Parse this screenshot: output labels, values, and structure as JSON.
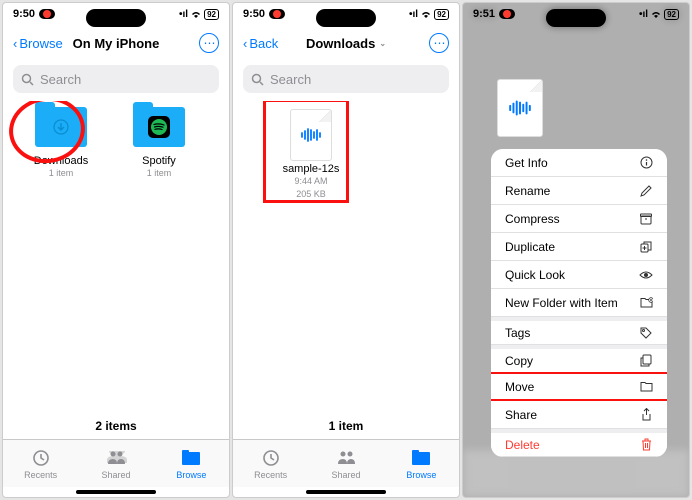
{
  "status": {
    "time": "9:50",
    "time3": "9:51",
    "camOn": true,
    "battery": "92"
  },
  "screen1": {
    "back": "Browse",
    "title": "On My iPhone",
    "search_placeholder": "Search",
    "items": [
      {
        "name": "Downloads",
        "meta": "1 item",
        "kind": "folder-download",
        "highlight": "circle"
      },
      {
        "name": "Spotify",
        "meta": "1 item",
        "kind": "app-spotify"
      }
    ],
    "footer": "2 items"
  },
  "screen2": {
    "back": "Back",
    "title": "Downloads",
    "search_placeholder": "Search",
    "items": [
      {
        "name": "sample-12s",
        "time": "9:44 AM",
        "size": "205 KB",
        "kind": "audio-file",
        "highlight": "rect"
      }
    ],
    "footer": "1 item"
  },
  "tabs": [
    {
      "label": "Recents",
      "icon": "clock"
    },
    {
      "label": "Shared",
      "icon": "shared"
    },
    {
      "label": "Browse",
      "icon": "browse",
      "active": true
    }
  ],
  "context_menu": [
    {
      "label": "Get Info",
      "icon": "info"
    },
    {
      "label": "Rename",
      "icon": "pencil"
    },
    {
      "label": "Compress",
      "icon": "archive"
    },
    {
      "label": "Duplicate",
      "icon": "duplicate"
    },
    {
      "label": "Quick Look",
      "icon": "eye"
    },
    {
      "label": "New Folder with Item",
      "icon": "folder-plus"
    },
    {
      "label": "Tags",
      "icon": "tag",
      "sep": true
    },
    {
      "label": "Copy",
      "icon": "copy",
      "sep": true
    },
    {
      "label": "Move",
      "icon": "move",
      "highlight": true
    },
    {
      "label": "Share",
      "icon": "share"
    },
    {
      "label": "Delete",
      "icon": "trash",
      "sep": true,
      "destructive": true
    }
  ]
}
